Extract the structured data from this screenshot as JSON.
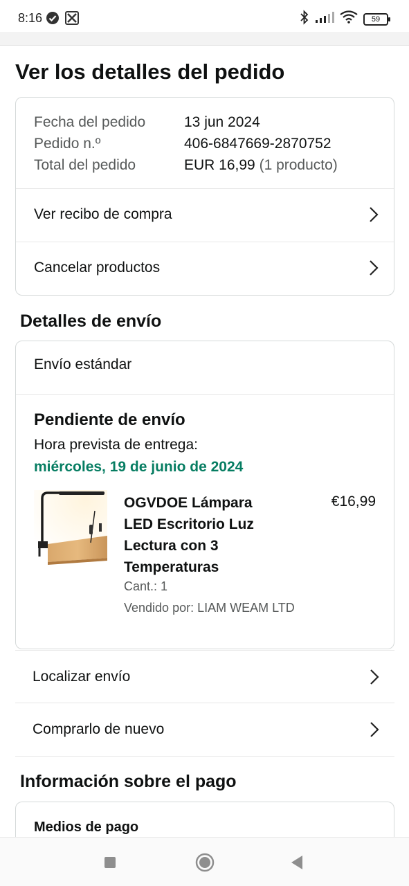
{
  "status_bar": {
    "time": "8:16",
    "battery": "59",
    "icons": [
      "check-circle-icon",
      "app-icon",
      "bluetooth-icon",
      "signal-icon",
      "wifi-icon",
      "battery-icon"
    ]
  },
  "page": {
    "title": "Ver los detalles del pedido"
  },
  "order_summary": {
    "rows": [
      {
        "label": "Fecha del pedido",
        "value": "13 jun 2024"
      },
      {
        "label": "Pedido n.º",
        "value": "406-6847669-2870752"
      },
      {
        "label": "Total del pedido",
        "value": "EUR 16,99",
        "extra": "(1 producto)"
      }
    ],
    "links": [
      {
        "label": "Ver recibo de compra",
        "icon": "chevron-right-icon"
      },
      {
        "label": "Cancelar productos",
        "icon": "chevron-right-icon"
      }
    ]
  },
  "shipping": {
    "section_title": "Detalles de envío",
    "method": "Envío estándar",
    "status": "Pendiente de envío",
    "eta_label": "Hora prevista de entrega:",
    "eta_date": "miércoles, 19 de junio de 2024",
    "product": {
      "title": "OGVDOE Lámpara LED Escritorio Luz Lectura con 3 Temperaturas",
      "price": "€16,99",
      "quantity": "Cant.: 1",
      "seller": "Vendido por: LIAM WEAM LTD",
      "image_icon": "desk-lamp-product-image"
    },
    "links": [
      {
        "label": "Localizar envío",
        "icon": "chevron-right-icon"
      },
      {
        "label": "Comprarlo de nuevo",
        "icon": "chevron-right-icon"
      }
    ]
  },
  "payment": {
    "section_title": "Información sobre el pago",
    "subtitle": "Medios de pago"
  },
  "nav_bar": {
    "buttons": [
      "recents-square-icon",
      "home-circle-icon",
      "back-triangle-icon"
    ]
  },
  "colors": {
    "accent_green": "#067d62",
    "text": "#0f1111",
    "muted": "#565959",
    "border": "#d5d9d9"
  }
}
